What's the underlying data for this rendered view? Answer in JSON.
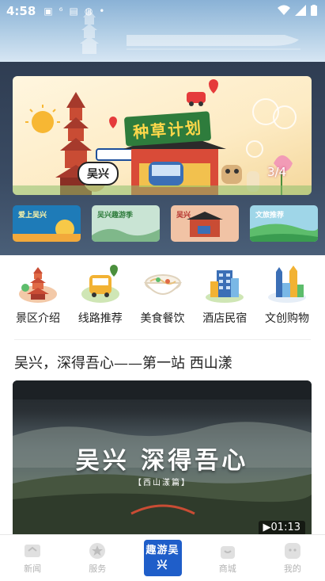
{
  "status_bar": {
    "time": "4:58",
    "icons": [
      "image-icon",
      "6-icon",
      "gallery-icon",
      "app-icon",
      "dot-icon",
      "wifi-icon",
      "signal-icon",
      "battery-icon"
    ]
  },
  "banner": {
    "title": "种草计划",
    "bubble": "吴兴",
    "page_indicator": "3/4"
  },
  "thumbnails": [
    {
      "text": "爱上吴兴",
      "bg": "#1e7bb8",
      "fg": "#fff6a8"
    },
    {
      "text": "吴兴趣游季",
      "bg": "#c9e4d4",
      "fg": "#2e7c3c"
    },
    {
      "text": "吴兴",
      "bg": "#f1c3a5",
      "fg": "#b4332e"
    },
    {
      "text": "文旅推荐",
      "bg": "#5dbd6c",
      "fg": "#ffffff"
    }
  ],
  "categories": [
    {
      "label": "景区介绍",
      "icon": "pagoda-icon"
    },
    {
      "label": "线路推荐",
      "icon": "bus-route-icon"
    },
    {
      "label": "美食餐饮",
      "icon": "noodle-bowl-icon"
    },
    {
      "label": "酒店民宿",
      "icon": "hotel-building-icon"
    },
    {
      "label": "文创购物",
      "icon": "shopping-towers-icon"
    }
  ],
  "article": {
    "title": "吴兴，深得吾心——第一站  西山漾",
    "video_headline": "吴兴  深得吾心",
    "video_subtitle": "【西山漾篇】",
    "duration": "▶01:13"
  },
  "bottom_nav": {
    "items": [
      {
        "label": "新闻",
        "icon": "news-icon"
      },
      {
        "label": "服务",
        "icon": "service-star-icon"
      },
      {
        "label": "趣游吴兴",
        "icon": "center-logo-icon"
      },
      {
        "label": "商城",
        "icon": "shop-bag-icon"
      },
      {
        "label": "我的",
        "icon": "profile-icon"
      }
    ]
  },
  "colors": {
    "center_button": "#1f5ec9",
    "banner_title_bg": "#2e7c3c",
    "nav_inactive": "#b3b3b3"
  }
}
